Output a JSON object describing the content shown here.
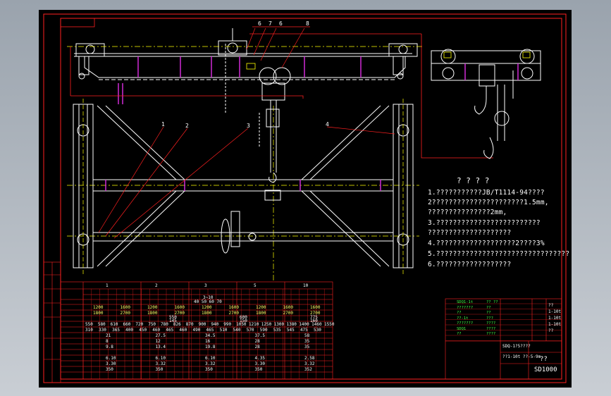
{
  "drawing": {
    "notes_title": "? ? ? ?",
    "notes": [
      "1.???????????JB/T1114-94????",
      "2??????????????????????1.5mm,",
      "  ???????????????2mm,",
      "3.?????????????????????????",
      "  ????????????????????",
      "4.???????????????????2????3%",
      "5.????????????????????????????????",
      "6.??????????????????"
    ],
    "callouts": [
      "6",
      "7",
      "6",
      "8",
      "1",
      "2",
      "3",
      "4"
    ],
    "drawing_code": "SD1000",
    "scale_label": "??",
    "title_block_text": "SDQ-1?5????",
    "title_block_text2": "??1-10t ??-5-9m",
    "table": {
      "header_groups": [
        "1",
        "2",
        "3",
        "5",
        "10"
      ],
      "row_span_top": "3~10",
      "row_span_top2": "40 50 60 70",
      "row_a": [
        "1200",
        "1600",
        "1200",
        "1600",
        "1200",
        "1600",
        "1200",
        "1600",
        "1600"
      ],
      "row_b": [
        "1800",
        "2700",
        "1800",
        "2700",
        "1800",
        "2700",
        "1800",
        "2700",
        "2700"
      ],
      "row_c": [
        "550",
        "600",
        "775"
      ],
      "row_d": [
        "145",
        "150",
        "160"
      ],
      "row_e1": [
        "550",
        "580",
        "610",
        "660",
        "720",
        "750",
        "780",
        "826",
        "870",
        "900",
        "940",
        "990",
        "1050",
        "1210",
        "1250",
        "1300",
        "1380",
        "1400",
        "1460",
        "1550"
      ],
      "row_e2": [
        "310",
        "330",
        "365",
        "400",
        "450",
        "460",
        "465",
        "460",
        "490",
        "465",
        "510",
        "540",
        "570",
        "590",
        "535",
        "545",
        "475",
        "530"
      ],
      "row_f": [
        "21",
        "27.5",
        "34.5",
        "37.5",
        "58"
      ],
      "row_g": [
        "8",
        "12",
        "16",
        "28",
        "35"
      ],
      "row_h": [
        "9.8",
        "13.4",
        "19.8",
        "28",
        "35"
      ],
      "row_i": [
        "6.10",
        "6.10",
        "6.10",
        "4.35",
        "2.58"
      ],
      "row_j": [
        "3.30",
        "3.32",
        "3.32",
        "3.30",
        "3.32"
      ],
      "row_k": [
        "350",
        "350",
        "350",
        "350",
        "352"
      ]
    },
    "title_block_green": [
      "SDQ1-1t",
      "???????",
      "??",
      "??-1t",
      "???????",
      "SDQ1",
      "??"
    ],
    "title_block_green2": [
      "?? ??",
      "??",
      "??",
      "???",
      "????",
      "????",
      "????"
    ],
    "title_block_right": [
      "??",
      "1-10t",
      "1-10t",
      "1-10t",
      "??"
    ]
  },
  "colors": {
    "background": "#000000",
    "frame": "#ff2020",
    "structure": "#ffffff",
    "accent": "#d02bd6",
    "centerline": "#ffff00",
    "green": "#44ff44",
    "cyan": "#00ffff"
  }
}
